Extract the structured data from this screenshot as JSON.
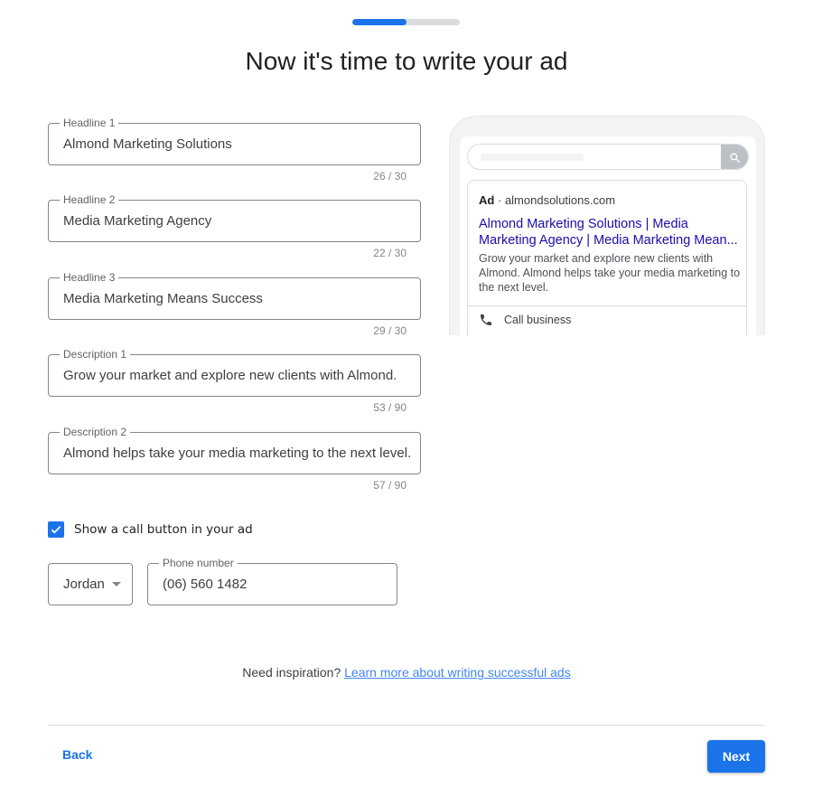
{
  "progress": {
    "value_percent": 50,
    "fill_color": "#1a73e8",
    "track_color": "#dadce0"
  },
  "page_title": "Now it's time to write your ad",
  "fields": [
    {
      "label": "Headline 1",
      "value": "Almond Marketing Solutions",
      "counter": "26 / 30"
    },
    {
      "label": "Headline 2",
      "value": "Media Marketing Agency",
      "counter": "22 / 30"
    },
    {
      "label": "Headline 3",
      "value": "Media Marketing Means Success",
      "counter": "29 / 30"
    },
    {
      "label": "Description 1",
      "value": "Grow your market and explore new clients with Almond.",
      "counter": "53 / 90"
    },
    {
      "label": "Description 2",
      "value": "Almond helps take your media marketing to the next level.",
      "counter": "57 / 90"
    }
  ],
  "preview": {
    "ad_badge": "Ad",
    "separator": "·",
    "domain": "almondsolutions.com",
    "title": "Almond Marketing Solutions | Media Marketing Agency | Media Marketing Mean...",
    "description": "Grow your market and explore new clients with Almond. Almond helps take your media marketing to the next level.",
    "call_label": "Call business",
    "search_icon": "search-icon",
    "phone_icon": "phone-icon"
  },
  "call_button": {
    "checked": true,
    "label": "Show a call button in your ad",
    "country": "Jordan",
    "phone_label": "Phone number",
    "phone_value": "(06) 560 1482"
  },
  "inspiration": {
    "text": "Need inspiration?",
    "link": "Learn more about writing successful ads"
  },
  "footer": {
    "back_label": "Back",
    "next_label": "Next"
  },
  "colors": {
    "accent": "#1a73e8",
    "ad_title": "#1a0dab",
    "link": "#4285f4"
  }
}
